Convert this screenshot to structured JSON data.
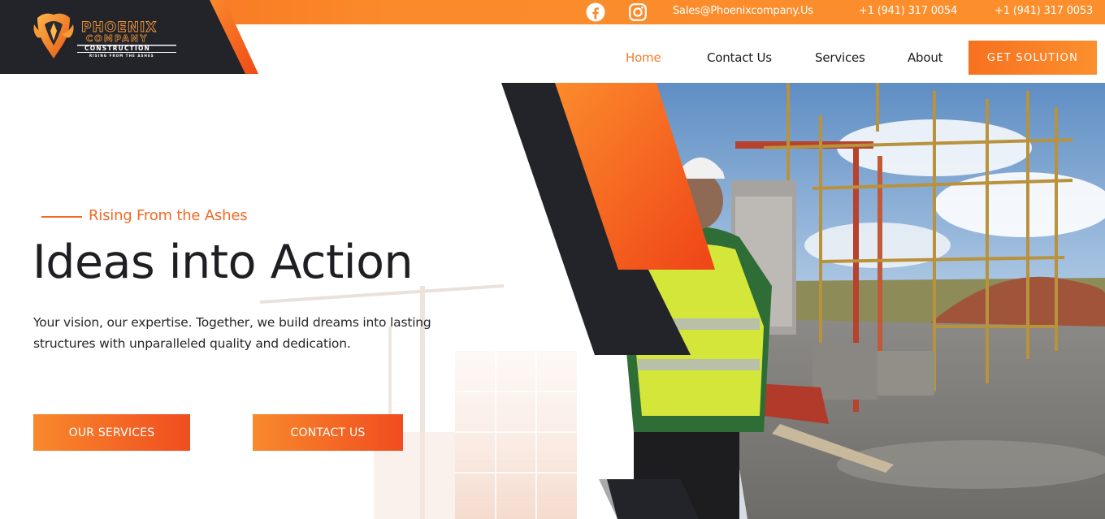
{
  "topbar": {
    "email": "Sales@Phoenixcompany.Us",
    "phone_1": "+1 (941) 317 0054",
    "phone_2": "+1 (941) 317 0053",
    "social_icons": [
      "facebook-icon",
      "instagram-icon"
    ]
  },
  "logo": {
    "wordmark_line1": "PHOENIX",
    "wordmark_line2": "COMPANY",
    "wordmark_line3": "CONSTRUCTION",
    "tagline": "RISING FROM THE ASHES"
  },
  "nav": {
    "items": [
      {
        "label": "Home",
        "active": true
      },
      {
        "label": "Contact Us",
        "active": false
      },
      {
        "label": "Services",
        "active": false
      },
      {
        "label": "About",
        "active": false
      }
    ],
    "cta_label": "GET SOLUTION"
  },
  "hero": {
    "eyebrow": "Rising From the Ashes",
    "headline": "Ideas into Action",
    "subcopy": "Your vision, our expertise. Together, we build dreams into lasting structures with unparalleled quality and dedication.",
    "primary_button": "OUR SERVICES",
    "secondary_button": "CONTACT US"
  },
  "colors": {
    "accent": "#f7711f",
    "accent_light": "#fb8f2e",
    "dark": "#23232a",
    "text": "#1f1f23"
  }
}
